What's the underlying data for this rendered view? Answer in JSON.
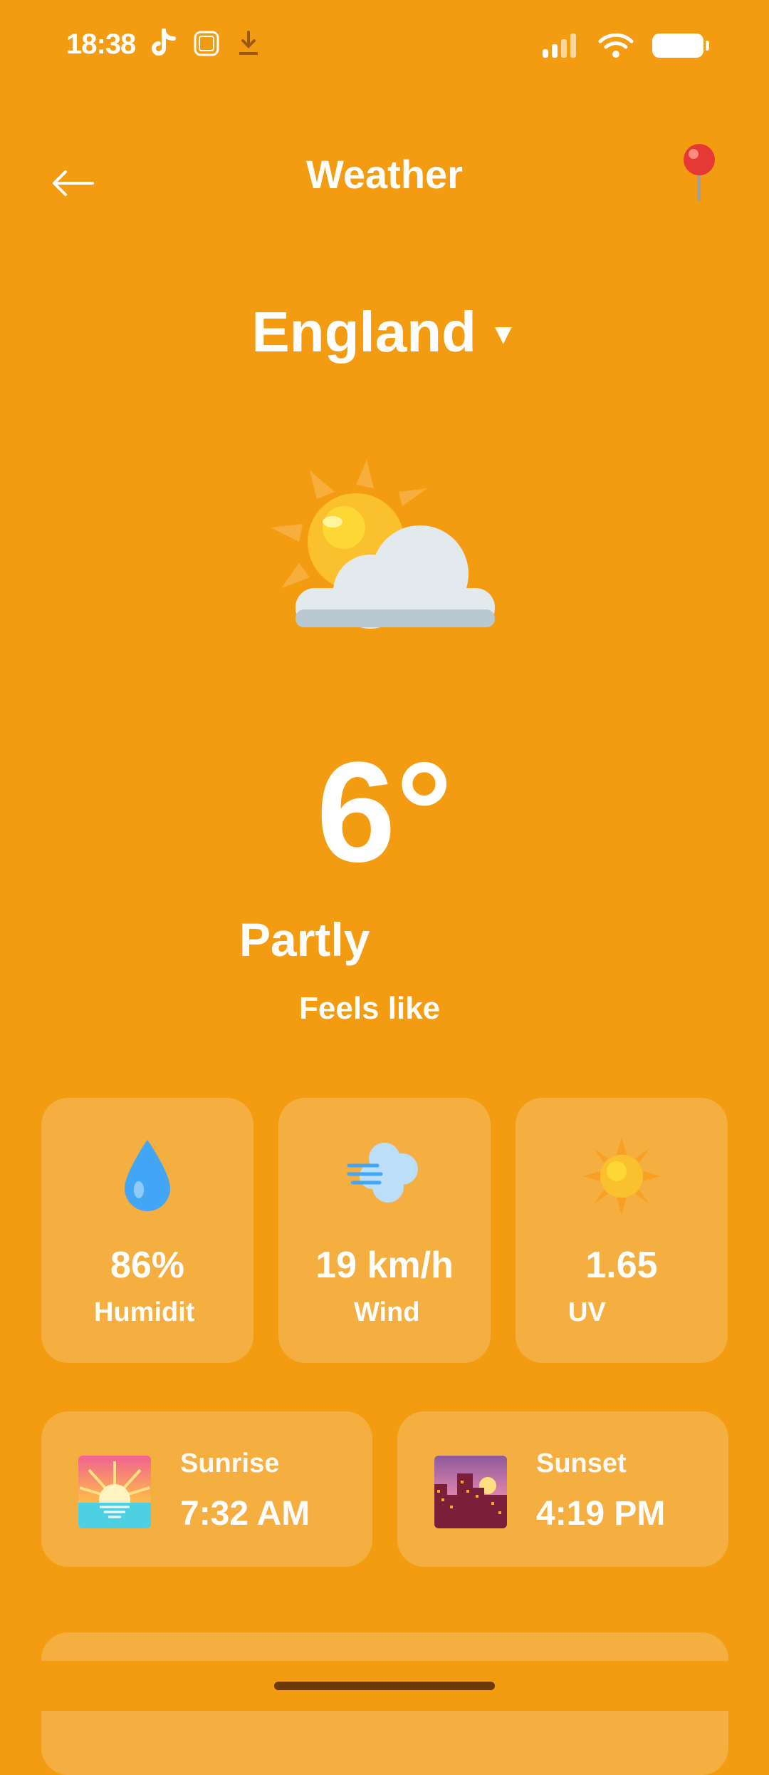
{
  "status_bar": {
    "time": "18:38"
  },
  "header": {
    "title": "Weather"
  },
  "location": {
    "name": "England"
  },
  "current": {
    "temperature": "6°",
    "condition": "Partly",
    "feels_like_label": "Feels like"
  },
  "stats": [
    {
      "value": "86%",
      "label": "Humidit",
      "icon": "droplet-icon"
    },
    {
      "value": "19 km/h",
      "label": "Wind",
      "icon": "wind-icon"
    },
    {
      "value": "1.65",
      "label": "UV",
      "icon": "sun-icon"
    }
  ],
  "sun_times": {
    "sunrise": {
      "label": "Sunrise",
      "value": "7:32 AM"
    },
    "sunset": {
      "label": "Sunset",
      "value": "4:19 PM"
    }
  },
  "colors": {
    "background": "#F39C12",
    "card": "rgba(255,255,255,0.20)",
    "text": "#FFFFFF"
  }
}
